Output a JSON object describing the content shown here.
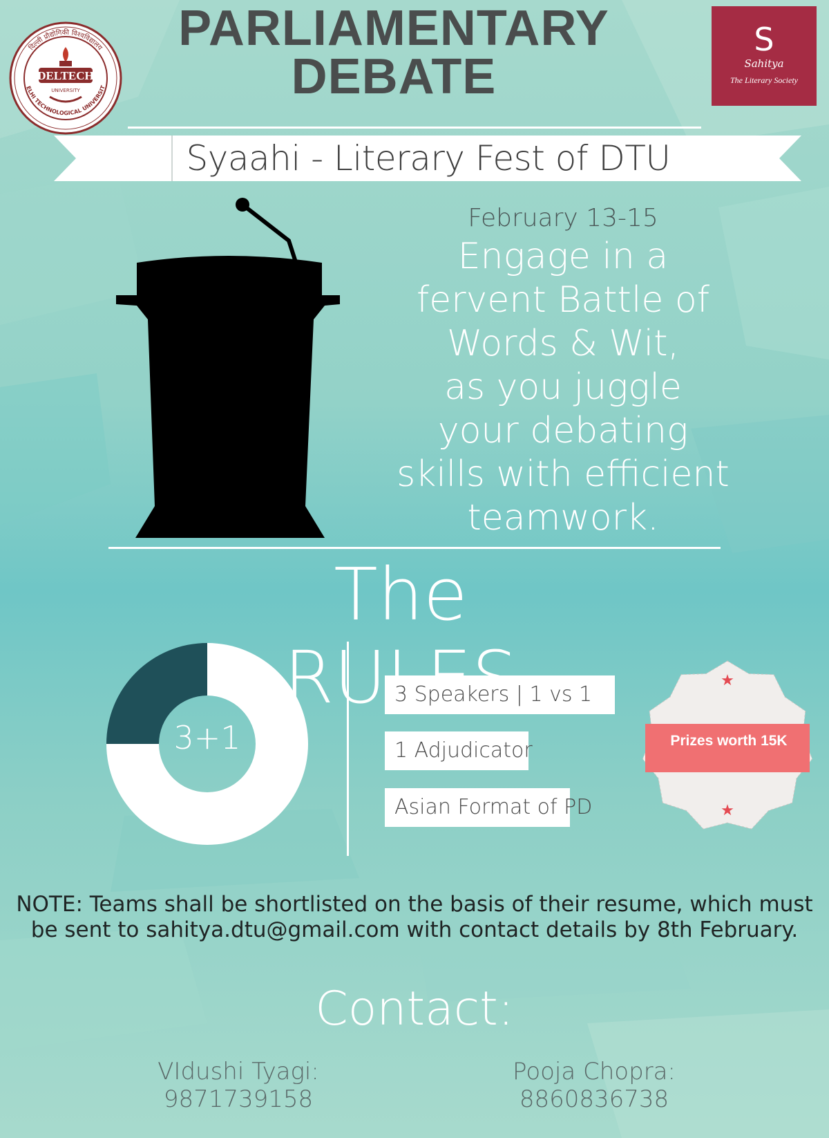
{
  "header": {
    "title_line1": "PARLIAMENTARY",
    "title_line2": "DEBATE",
    "left_logo": {
      "hindi_text": "दिल्ली प्रौद्योगिकी विश्वविद्यालय",
      "brand": "DELTECH",
      "sub": "UNIVERSITY",
      "ring_text": "DELHI TECHNOLOGICAL UNIVERSITY"
    },
    "right_logo": {
      "symbol": "S",
      "name": "Sahitya",
      "subtitle": "The Literary Society",
      "color": "#a52c44"
    }
  },
  "ribbon": {
    "text": "Syaahi - Literary Fest of DTU"
  },
  "intro": {
    "date": "February 13-15",
    "tagline": [
      "Engage in a",
      "fervent Battle of",
      "Words & Wit,",
      "as you juggle",
      "your debating",
      "skills with efficient",
      "teamwork."
    ]
  },
  "rules": {
    "title": "The RULES",
    "donut": {
      "label": "3+1",
      "dark_fraction": 0.25,
      "dark_color": "#1f5059",
      "light_color": "#ffffff"
    },
    "items": [
      "3 Speakers | 1 vs 1",
      "1 Adjudicator",
      "Asian Format of PD"
    ],
    "prize": {
      "text": "Prizes worth 15K",
      "band_color": "#f07072",
      "badge_color": "#f1eeec"
    }
  },
  "note": {
    "line1": "NOTE: Teams shall be shortlisted on the basis of their resume, which must",
    "line2": "be sent to sahitya.dtu@gmail.com with contact details by 8th February."
  },
  "contact": {
    "title": "Contact:",
    "people": [
      "VIdushi Tyagi: 9871739158",
      "Pooja Chopra: 8860836738"
    ]
  }
}
